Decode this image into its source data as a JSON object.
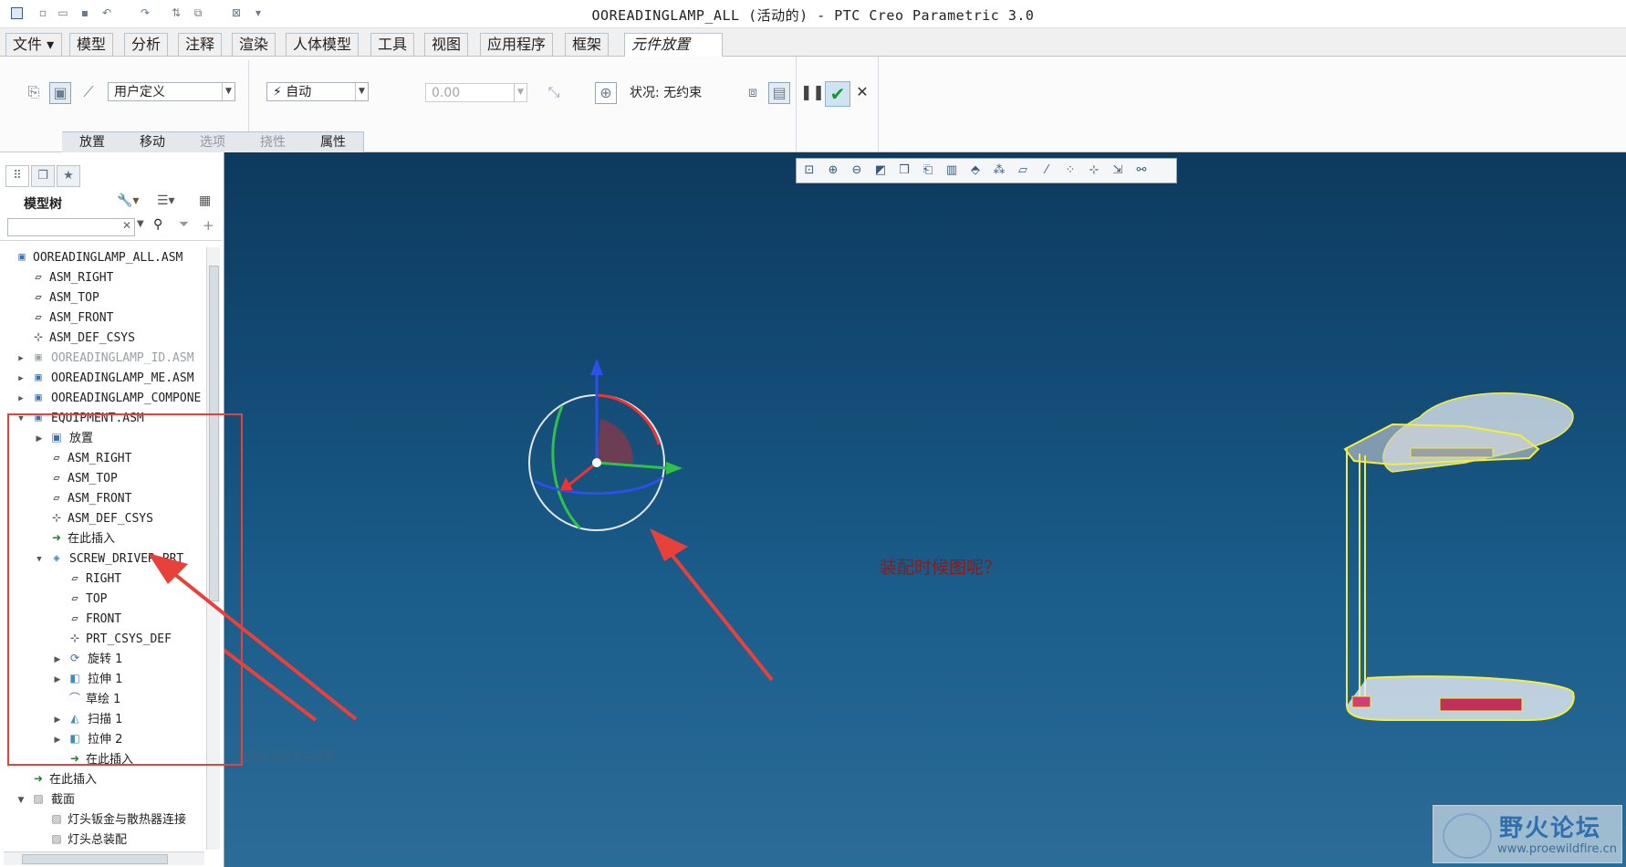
{
  "window": {
    "title": "OOREADINGLAMP_ALL (活动的) - PTC Creo Parametric 3.0"
  },
  "menu_tabs": [
    "文件",
    "模型",
    "分析",
    "注释",
    "渲染",
    "人体模型",
    "工具",
    "视图",
    "应用程序",
    "框架",
    "元件放置"
  ],
  "ribbon": {
    "constraint_set": "用户定义",
    "constraint_type": "自动",
    "offset_value": "0.00",
    "status": "状况: 无约束",
    "subtabs": [
      "放置",
      "移动",
      "选项",
      "挠性",
      "属性"
    ]
  },
  "model_tree": {
    "header": "模型树",
    "rows": [
      "OOREADINGLAMP_ALL.ASM",
      "ASM_RIGHT",
      "ASM_TOP",
      "ASM_FRONT",
      "ASM_DEF_CSYS",
      "OOREADINGLAMP_ID.ASM",
      "OOREADINGLAMP_ME.ASM",
      "OOREADINGLAMP_COMPONE",
      "EQUIPMENT.ASM",
      "放置",
      "ASM_RIGHT",
      "ASM_TOP",
      "ASM_FRONT",
      "ASM_DEF_CSYS",
      "在此插入",
      "SCREW_DRIVER.PRT",
      "RIGHT",
      "TOP",
      "FRONT",
      "PRT_CSYS_DEF",
      "旋转 1",
      "拉伸 1",
      "草绘 1",
      "扫描 1",
      "拉伸 2",
      "在此插入",
      "在此插入",
      "截面",
      "灯头钣金与散热器连接",
      "灯头总装配"
    ]
  },
  "viewport": {
    "annotation_question": "装配时候图呢？",
    "faint_label": "后装状态灯头总装配",
    "watermark_title": "野火论坛",
    "watermark_url": "www.proewildfire.cn"
  },
  "colors": {
    "annotation": "#e8413c",
    "viewport_top": "#0d3a5e",
    "viewport_bottom": "#2b6c98",
    "model_outline": "#f3ef3a"
  }
}
